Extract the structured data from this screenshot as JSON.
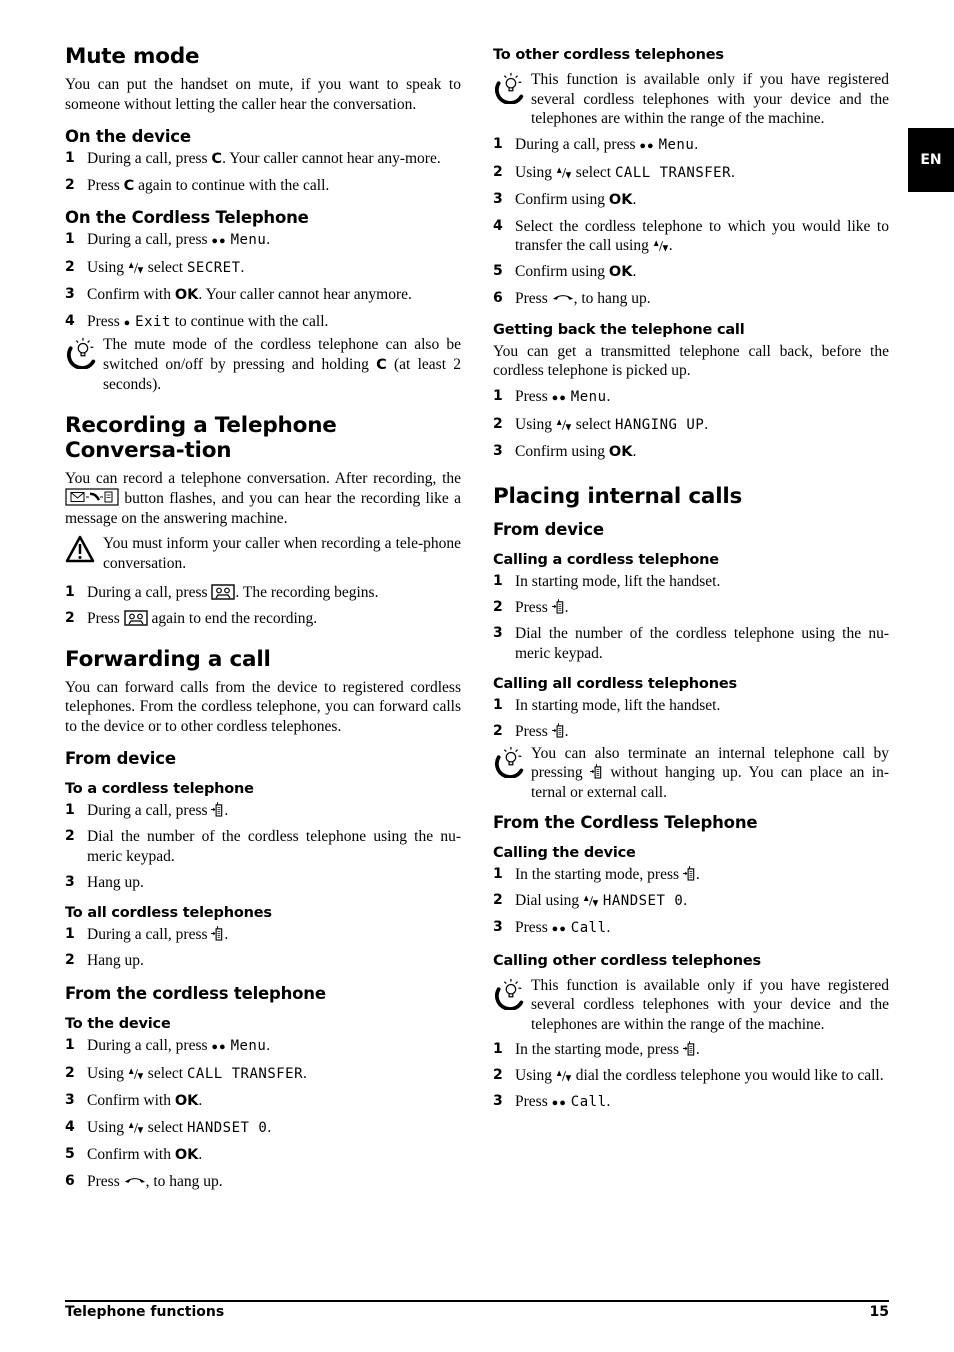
{
  "page": {
    "language_tab": "EN",
    "footer_title": "Telephone functions",
    "page_number": "15"
  },
  "icons": {
    "tip": "lightbulb-tip-icon",
    "warning": "warning-triangle-icon",
    "arrows": "up-down-arrows-icon",
    "intercom": "intercom-handset-icon",
    "record": "cassette-record-icon",
    "hangup": "hang-up-handset-icon",
    "message": "message-button-icon",
    "softkey_dots": "●●",
    "softkey_dot": "●"
  },
  "left": {
    "mute": {
      "title": "Mute mode",
      "intro": "You can put the handset on mute, if you want to speak to someone without letting the caller hear the conversation.",
      "device_heading": "On the device",
      "device_steps": [
        {
          "num": "1",
          "a": "During a call, press ",
          "key": "C",
          "b": ". Your caller cannot hear any-more."
        },
        {
          "num": "2",
          "a": "Press ",
          "key": "C",
          "b": " again to continue with the call."
        }
      ],
      "cordless_heading": "On the Cordless Telephone",
      "cordless_steps": [
        {
          "num": "1",
          "a": "During a call, press ",
          "dots": "●●",
          "display": "Menu",
          "b": "."
        },
        {
          "num": "2",
          "a": "Using ",
          "arrows": "▲/▼",
          "mid": " select ",
          "display": "SECRET",
          "b": "."
        },
        {
          "num": "3",
          "a": "Confirm with ",
          "key": "OK",
          "b": ". Your caller cannot hear anymore."
        },
        {
          "num": "4",
          "a": " Press ",
          "dots": "●",
          "display": "Exit",
          "b": " to continue with the call."
        }
      ],
      "tip_a": "The mute mode of the cordless telephone can also be switched on/off by pressing and holding ",
      "tip_key": "C",
      "tip_b": " (at least 2 seconds)."
    },
    "recording": {
      "title": "Recording a Telephone Conversa-tion",
      "intro_a": "You can record a telephone conversation. After recording, the ",
      "intro_b": " button flashes, and you can hear the recording like a message on the answering machine.",
      "warning": "You must inform your caller when recording a tele-phone conversation.",
      "steps": [
        {
          "num": "1",
          "a": "During a call, press ",
          "b": ". The recording begins."
        },
        {
          "num": "2",
          "a": "Press ",
          "b": " again to end the recording."
        }
      ]
    },
    "forwarding": {
      "title": "Forwarding a call",
      "intro": "You can forward calls from the device to registered cordless telephones. From the cordless telephone, you can forward calls to the device or to other cordless telephones.",
      "from_device_heading": "From device",
      "to_cordless_heading": "To a cordless telephone",
      "to_cordless_steps": [
        {
          "num": "1",
          "a": "During a call, press ",
          "b": "."
        },
        {
          "num": "2",
          "a": "Dial the number of the cordless telephone using the nu-meric keypad."
        },
        {
          "num": "3",
          "a": "Hang up."
        }
      ],
      "to_all_heading": "To all cordless telephones",
      "to_all_steps": [
        {
          "num": "1",
          "a": "During a call, press ",
          "b": "."
        },
        {
          "num": "2",
          "a": "Hang up."
        }
      ],
      "from_cordless_heading": "From the cordless telephone",
      "to_device_heading": "To the device",
      "to_device_steps": [
        {
          "num": "1",
          "a": "During a call, press ",
          "dots": "●●",
          "display": "Menu",
          "b": "."
        },
        {
          "num": "2",
          "a": "Using ",
          "arrows": "▲/▼",
          "mid": " select ",
          "display": "CALL TRANSFER",
          "b": "."
        },
        {
          "num": "3",
          "a": "Confirm with ",
          "key": "OK",
          "b": "."
        },
        {
          "num": "4",
          "a": "Using ",
          "arrows": "▲/▼",
          "mid": " select ",
          "display": "HANDSET 0",
          "b": "."
        },
        {
          "num": "5",
          "a": "Confirm with ",
          "key": "OK",
          "b": "."
        },
        {
          "num": "6",
          "a": "Press ",
          "b": ", to hang up."
        }
      ]
    }
  },
  "right": {
    "to_other": {
      "heading": "To other cordless telephones",
      "tip": "This function is available only if you have registered several cordless telephones with your device and the telephones are within the range of the machine.",
      "steps": [
        {
          "num": "1",
          "a": "During a call, press ",
          "dots": "●●",
          "display": "Menu",
          "b": "."
        },
        {
          "num": "2",
          "a": "Using ",
          "arrows": "▲/▼",
          "mid": " select ",
          "display": "CALL TRANSFER",
          "b": "."
        },
        {
          "num": "3",
          "a": "Confirm using ",
          "key": "OK",
          "b": "."
        },
        {
          "num": "4",
          "a": "Select the cordless telephone to which you would like to transfer the call using ",
          "arrows": "▲/▼",
          "b": "."
        },
        {
          "num": "5",
          "a": "Confirm using ",
          "key": "OK",
          "b": "."
        },
        {
          "num": "6",
          "a": "Press ",
          "b": ", to hang up."
        }
      ]
    },
    "getting_back": {
      "heading": "Getting back the telephone call",
      "intro": "You can get a transmitted telephone call back, before the cordless telephone is picked up.",
      "steps": [
        {
          "num": "1",
          "a": "Press ",
          "dots": "●●",
          "display": "Menu",
          "b": "."
        },
        {
          "num": "2",
          "a": "Using ",
          "arrows": "▲/▼",
          "mid": " select ",
          "display": "HANGING UP",
          "b": "."
        },
        {
          "num": "3",
          "a": "Confirm using ",
          "key": "OK",
          "b": "."
        }
      ]
    },
    "internal": {
      "title": "Placing internal calls",
      "from_device_heading": "From device",
      "calling_one_heading": "Calling a cordless telephone",
      "calling_one_steps": [
        {
          "num": "1",
          "a": "In starting mode, lift the handset."
        },
        {
          "num": "2",
          "a": "Press ",
          "b": "."
        },
        {
          "num": "3",
          "a": "Dial the number of the cordless telephone using the nu-meric keypad."
        }
      ],
      "calling_all_heading": "Calling all cordless telephones",
      "calling_all_steps": [
        {
          "num": "1",
          "a": "In starting mode, lift the handset."
        },
        {
          "num": "2",
          "a": "Press ",
          "b": "."
        }
      ],
      "tip_a": "You can also terminate an internal telephone call by pressing ",
      "tip_b": " without hanging up. You can place an in-ternal or external call.",
      "from_cordless_heading": "From the Cordless Telephone",
      "calling_device_heading": "Calling the device",
      "calling_device_steps": [
        {
          "num": "1",
          "a": "In the starting mode, press ",
          "b": "."
        },
        {
          "num": "2",
          "a": " Dial using ",
          "arrows": "▲/▼",
          "display": "HANDSET 0",
          "b": "."
        },
        {
          "num": "3",
          "a": "Press ",
          "dots": "●●",
          "display": "Call",
          "b": "."
        }
      ],
      "calling_other_heading": "Calling other cordless telephones",
      "calling_other_tip": "This function is available only if you have registered several cordless telephones with your device and the telephones are within the range of the machine.",
      "calling_other_steps": [
        {
          "num": "1",
          "a": "In the starting mode, press ",
          "b": "."
        },
        {
          "num": "2",
          "a": "Using ",
          "arrows": "▲/▼",
          "b": " dial the cordless telephone you would like to call."
        },
        {
          "num": "3",
          "a": "Press ",
          "dots": "●●",
          "display": "Call",
          "b": "."
        }
      ]
    }
  }
}
